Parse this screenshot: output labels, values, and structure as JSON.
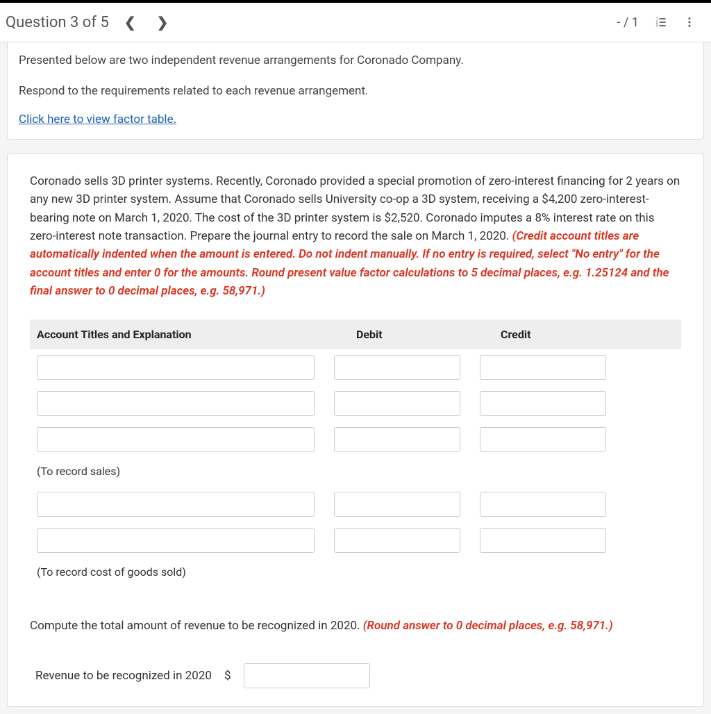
{
  "header": {
    "question_label": "Question 3 of 5",
    "score": "- / 1"
  },
  "intro": {
    "line1": "Presented below are two independent revenue arrangements for Coronado Company.",
    "line2": "Respond to the requirements related to each revenue arrangement.",
    "link": "Click here to view factor table."
  },
  "question": {
    "main_text": "Coronado sells 3D printer systems. Recently, Coronado provided a special promotion of zero-interest financing for 2 years on any new 3D printer system. Assume that Coronado sells University co-op a 3D system, receiving a $4,200 zero-interest-bearing note on March 1, 2020. The cost of the 3D printer system is $2,520. Coronado imputes a 8% interest rate on this zero-interest note transaction. Prepare the journal entry to record the sale on March 1, 2020. ",
    "instruction": "(Credit account titles are automatically indented when the amount is entered. Do not indent manually. If no entry is required, select \"No entry\" for the account titles and enter 0 for the amounts. Round present value factor calculations to 5 decimal places, e.g. 1.25124 and the final answer to 0 decimal places, e.g. 58,971.)"
  },
  "table": {
    "col_account": "Account Titles and Explanation",
    "col_debit": "Debit",
    "col_credit": "Credit",
    "note1": "(To record sales)",
    "note2": "(To record cost of goods sold)"
  },
  "compute": {
    "text": "Compute the total amount of revenue to be recognized in 2020. ",
    "instruction": "(Round answer to 0 decimal places, e.g. 58,971.)",
    "label": "Revenue to be recognized in 2020",
    "currency": "$"
  }
}
